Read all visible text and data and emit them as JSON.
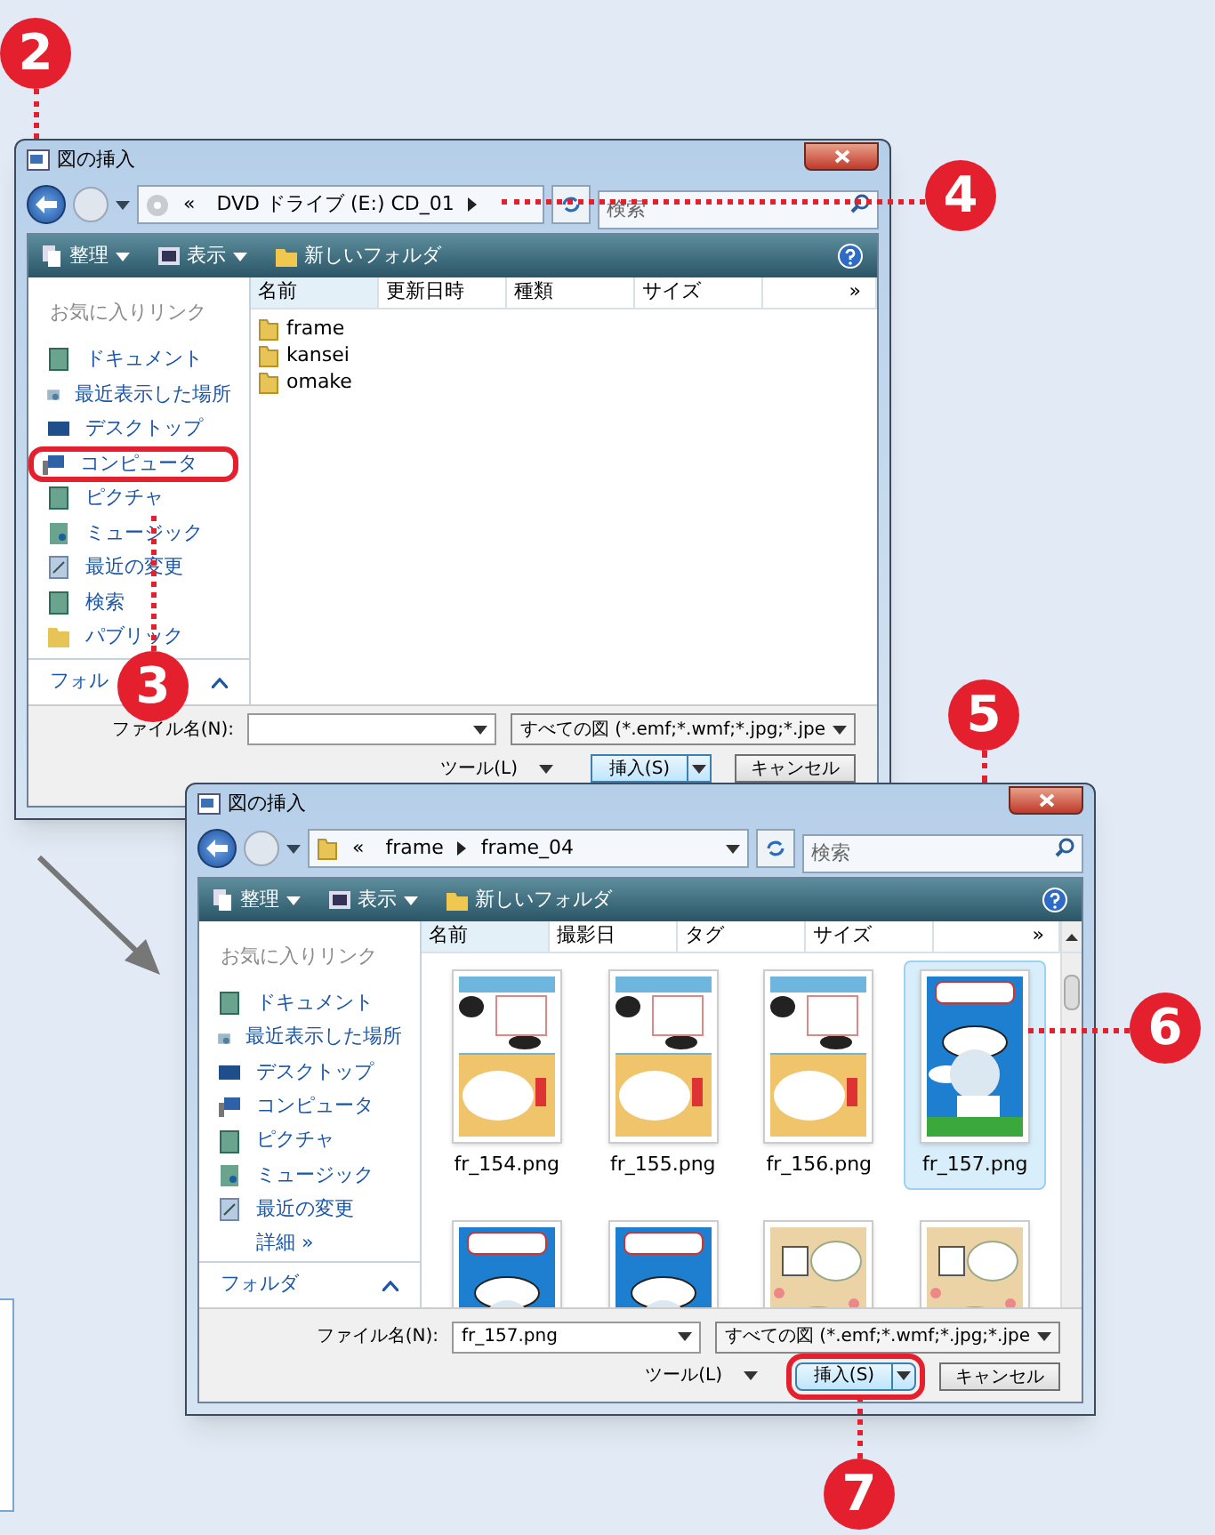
{
  "windows": [
    {
      "title": "図の挿入",
      "address_prefix": "«",
      "crumbs": [
        {
          "label": "DVD ドライブ (E:) CD_01",
          "arrow": true
        }
      ],
      "search_placeholder": "検索",
      "toolbar": [
        "整理",
        "表示",
        "新しいフォルダ"
      ],
      "favorites_heading": "お気に入りリンク",
      "sidebar": [
        {
          "label": "ドキュメント",
          "kind": "docs",
          "highlighted": false
        },
        {
          "label": "最近表示した場所",
          "kind": "recent",
          "highlighted": false
        },
        {
          "label": "デスクトップ",
          "kind": "desktop",
          "highlighted": false
        },
        {
          "label": "コンピュータ",
          "kind": "computer",
          "highlighted": true
        },
        {
          "label": "ピクチャ",
          "kind": "docs",
          "highlighted": false
        },
        {
          "label": "ミュージック",
          "kind": "music",
          "highlighted": false
        },
        {
          "label": "最近の変更",
          "kind": "changes",
          "highlighted": false
        },
        {
          "label": "検索",
          "kind": "docs",
          "highlighted": false
        },
        {
          "label": "パブリック",
          "kind": "folder",
          "highlighted": false
        }
      ],
      "folders_label": "フォル",
      "columns": [
        "名前",
        "更新日時",
        "種類",
        "サイズ",
        "»"
      ],
      "files": [
        {
          "name": "frame",
          "kind": "folder",
          "selected": false
        },
        {
          "name": "kansei",
          "kind": "folder",
          "selected": false
        },
        {
          "name": "omake",
          "kind": "folder",
          "selected": false
        }
      ],
      "file_name_label": "ファイル名(N):",
      "file_type": "すべての図 (*.emf;*.wmf;*.jpg;*.jpe",
      "tools": "ツール(L)",
      "insert": "挿入(S)",
      "insert_highlighted": false,
      "cancel": "キャンセル"
    },
    {
      "title": "図の挿入",
      "address_prefix": "«",
      "crumbs": [
        {
          "label": "frame",
          "arrow": true
        },
        {
          "label": "frame_04",
          "arrow": false
        }
      ],
      "search_placeholder": "検索",
      "toolbar": [
        "整理",
        "表示",
        "新しいフォルダ"
      ],
      "favorites_heading": "お気に入りリンク",
      "sidebar": [
        {
          "label": "ドキュメント",
          "kind": "docs",
          "highlighted": false
        },
        {
          "label": "最近表示した場所",
          "kind": "recent",
          "highlighted": false
        },
        {
          "label": "デスクトップ",
          "kind": "desktop",
          "highlighted": false
        },
        {
          "label": "コンピュータ",
          "kind": "computer",
          "highlighted": false
        },
        {
          "label": "ピクチャ",
          "kind": "docs",
          "highlighted": false
        },
        {
          "label": "ミュージック",
          "kind": "music",
          "highlighted": false
        },
        {
          "label": "最近の変更",
          "kind": "changes",
          "highlighted": false
        },
        {
          "label": "詳細 »",
          "kind": "more",
          "highlighted": false
        }
      ],
      "folders_label": "フォルダ",
      "columns": [
        "名前",
        "撮影日",
        "タグ",
        "サイズ",
        "»"
      ],
      "files": [
        {
          "name": "fr_154.png",
          "kind": "picture",
          "selected": false
        },
        {
          "name": "fr_155.png",
          "kind": "picture",
          "selected": false
        },
        {
          "name": "fr_156.png",
          "kind": "picture",
          "selected": false
        },
        {
          "name": "fr_157.png",
          "kind": "picture",
          "selected": true
        },
        {
          "kind": "picture",
          "selected": false
        },
        {
          "kind": "picture",
          "selected": false
        },
        {
          "kind": "picture",
          "selected": false
        },
        {
          "kind": "picture",
          "selected": false
        }
      ],
      "file_name_label": "ファイル名(N):",
      "file_name": "fr_157.png",
      "file_type": "すべての図 (*.emf;*.wmf;*.jpg;*.jpe",
      "tools": "ツール(L)",
      "insert": "挿入(S)",
      "insert_highlighted": true,
      "cancel": "キャンセル"
    }
  ],
  "callouts": [
    "2",
    "3",
    "4",
    "5",
    "6",
    "7"
  ]
}
